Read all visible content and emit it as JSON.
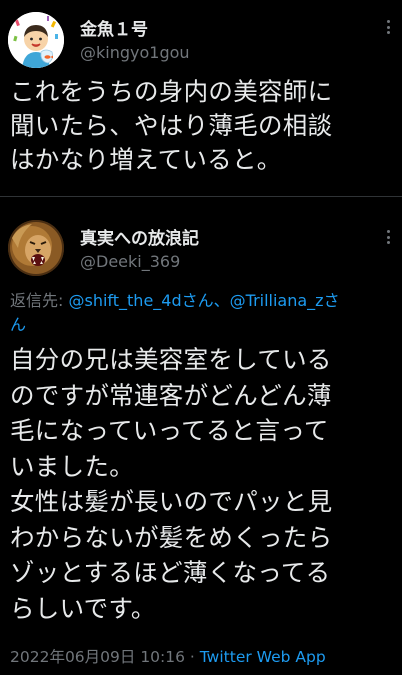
{
  "tweet1": {
    "display_name": "金魚１号",
    "handle": "@kingyo1gou",
    "text": "これをうちの身内の美容師に\n聞いたら、やはり薄毛の相談\nはかなり増えていると。",
    "avatar_icon": "cartoon-boy-holding-goldfish-avatar"
  },
  "tweet2": {
    "display_name": "真実への放浪記",
    "handle": "@Deeki_369",
    "replying_prefix": "返信先: ",
    "mention1": "@shift_the_4d",
    "mention1_suffix": "さん、",
    "mention2": "@Trilliana_z",
    "mention2_suffix": "さ\nん",
    "text": "自分の兄は美容室をしている\nのですが常連客がどんどん薄\n毛になっていってると言って\nいました。\n女性は髪が長いのでパッと見\nわからないが髪をめくったら\nゾッとするほど薄くなってる\nらしいです。",
    "timestamp": "2022年06月09日 10:16",
    "separator": " · ",
    "source_app": "Twitter Web App",
    "avatar_icon": "roaring-lion-avatar"
  },
  "colors": {
    "background": "#000000",
    "text_primary": "#e7e9ea",
    "text_secondary": "#71767b",
    "link": "#1d9bf0",
    "divider": "#2f3336"
  }
}
